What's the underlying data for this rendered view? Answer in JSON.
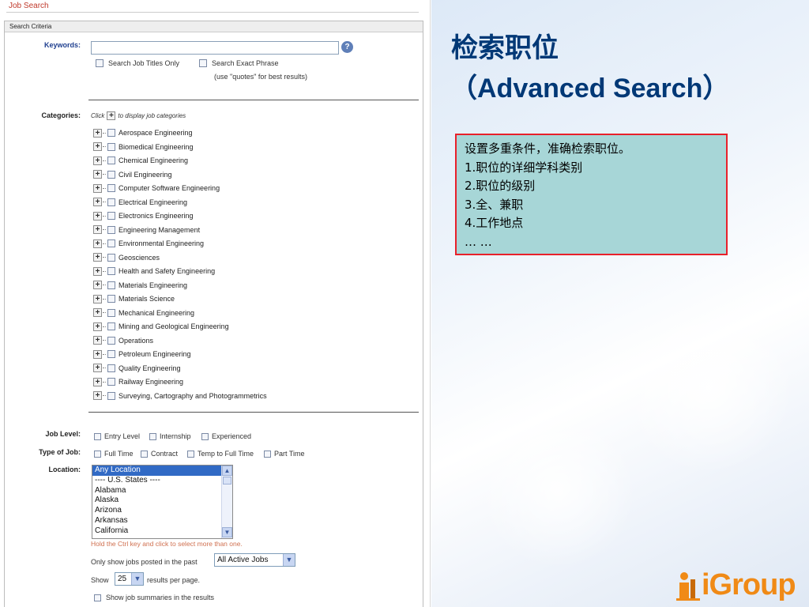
{
  "left": {
    "page_title": "Job Search",
    "section_header": "Search Criteria",
    "keywords": {
      "label": "Keywords:",
      "value": "",
      "help_icon": "question-circle-icon",
      "help_glyph": "?",
      "opt_titles": "Search Job Titles Only",
      "opt_exact": "Search Exact Phrase",
      "note": "(use \"quotes\" for best results)"
    },
    "categories": {
      "label": "Categories:",
      "hint_prefix": "Click",
      "hint_suffix": "to display job categories",
      "items": [
        "Aerospace Engineering",
        "Biomedical Engineering",
        "Chemical Engineering",
        "Civil Engineering",
        "Computer Software Engineering",
        "Electrical Engineering",
        "Electronics Engineering",
        "Engineering Management",
        "Environmental Engineering",
        "Geosciences",
        "Health and Safety Engineering",
        "Materials Engineering",
        "Materials Science",
        "Mechanical Engineering",
        "Mining and Geological Engineering",
        "Operations",
        "Petroleum Engineering",
        "Quality Engineering",
        "Railway Engineering",
        "Surveying, Cartography and Photogrammetrics"
      ]
    },
    "job_level": {
      "label": "Job Level:",
      "options": [
        "Entry Level",
        "Internship",
        "Experienced"
      ]
    },
    "job_type": {
      "label": "Type of Job:",
      "options": [
        "Full Time",
        "Contract",
        "Temp to Full Time",
        "Part Time"
      ]
    },
    "location": {
      "label": "Location:",
      "options": [
        "Any Location",
        "---- U.S. States ----",
        "Alabama",
        "Alaska",
        "Arizona",
        "Arkansas",
        "California"
      ],
      "selected": "Any Location",
      "hint": "Hold the Ctrl key and click to select more than one."
    },
    "posted": {
      "prefix": "Only show jobs posted in the past",
      "value": "All Active Jobs"
    },
    "show": {
      "prefix": "Show",
      "value": "25",
      "suffix": "results per page."
    },
    "summaries": "Show job summaries in the results"
  },
  "slide": {
    "title_cn": "检索职位",
    "title_en": "（Advanced Search）",
    "box_lines": [
      "设置多重条件，准确检索职位。",
      "1.职位的详细学科类别",
      "2.职位的级别",
      "3.全、兼职",
      "4.工作地点",
      "… …"
    ],
    "logo_text": "iGroup",
    "logo_color": "#f08a16"
  },
  "colors": {
    "title_blue": "#003876",
    "box_fill": "#a7d6d7",
    "box_border": "#e8202a",
    "select_highlight": "#316ac5"
  }
}
